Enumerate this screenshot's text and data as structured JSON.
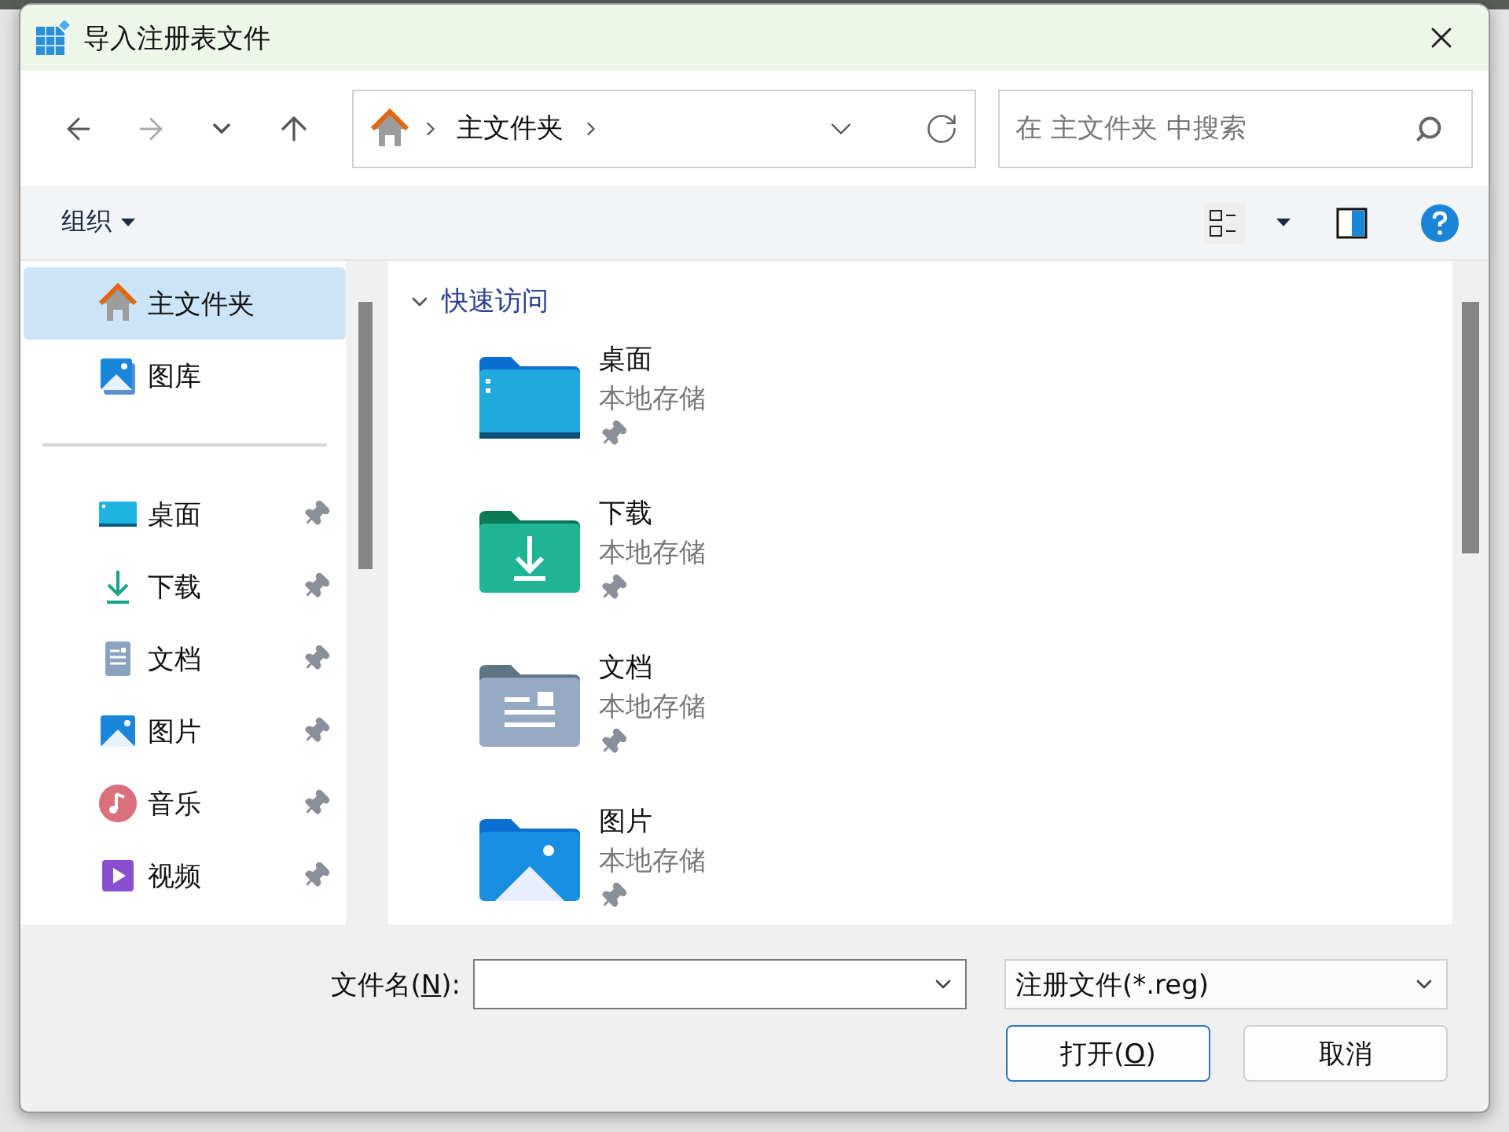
{
  "window": {
    "title": "导入注册表文件"
  },
  "nav": {
    "back": {
      "disabled": false
    },
    "forward": {
      "disabled": true
    },
    "breadcrumb": [
      {
        "label": "主文件夹"
      }
    ],
    "search": {
      "placeholder": "在 主文件夹 中搜索"
    }
  },
  "toolbar": {
    "organize": "组织"
  },
  "sidebar": {
    "top": [
      {
        "label": "主文件夹",
        "kind": "home",
        "selected": true,
        "pinned": false
      },
      {
        "label": "图库",
        "kind": "gallery",
        "selected": false,
        "pinned": false
      }
    ],
    "quick": [
      {
        "label": "桌面",
        "kind": "desktop",
        "selected": false,
        "pinned": true
      },
      {
        "label": "下载",
        "kind": "download",
        "selected": false,
        "pinned": true
      },
      {
        "label": "文档",
        "kind": "document",
        "selected": false,
        "pinned": true
      },
      {
        "label": "图片",
        "kind": "picture",
        "selected": false,
        "pinned": true
      },
      {
        "label": "音乐",
        "kind": "music",
        "selected": false,
        "pinned": true
      },
      {
        "label": "视频",
        "kind": "video",
        "selected": false,
        "pinned": true
      }
    ]
  },
  "main": {
    "section": {
      "label": "快速访问",
      "expanded": true
    },
    "items": [
      {
        "name": "桌面",
        "location": "本地存储",
        "kind": "desktop",
        "pinned": true
      },
      {
        "name": "下载",
        "location": "本地存储",
        "kind": "download",
        "pinned": true
      },
      {
        "name": "文档",
        "location": "本地存储",
        "kind": "document",
        "pinned": true
      },
      {
        "name": "图片",
        "location": "本地存储",
        "kind": "picture",
        "pinned": true
      }
    ]
  },
  "footer": {
    "filename": {
      "label_before": "文件名(",
      "mnemonic": "N",
      "label_after": "):"
    },
    "file_type": {
      "value": "注册文件(*.reg)"
    },
    "buttons": [
      {
        "label_before": "打开(",
        "mnemonic": "O",
        "label_after": ")",
        "default": true
      },
      {
        "label_before": "取消",
        "default": false
      }
    ]
  }
}
